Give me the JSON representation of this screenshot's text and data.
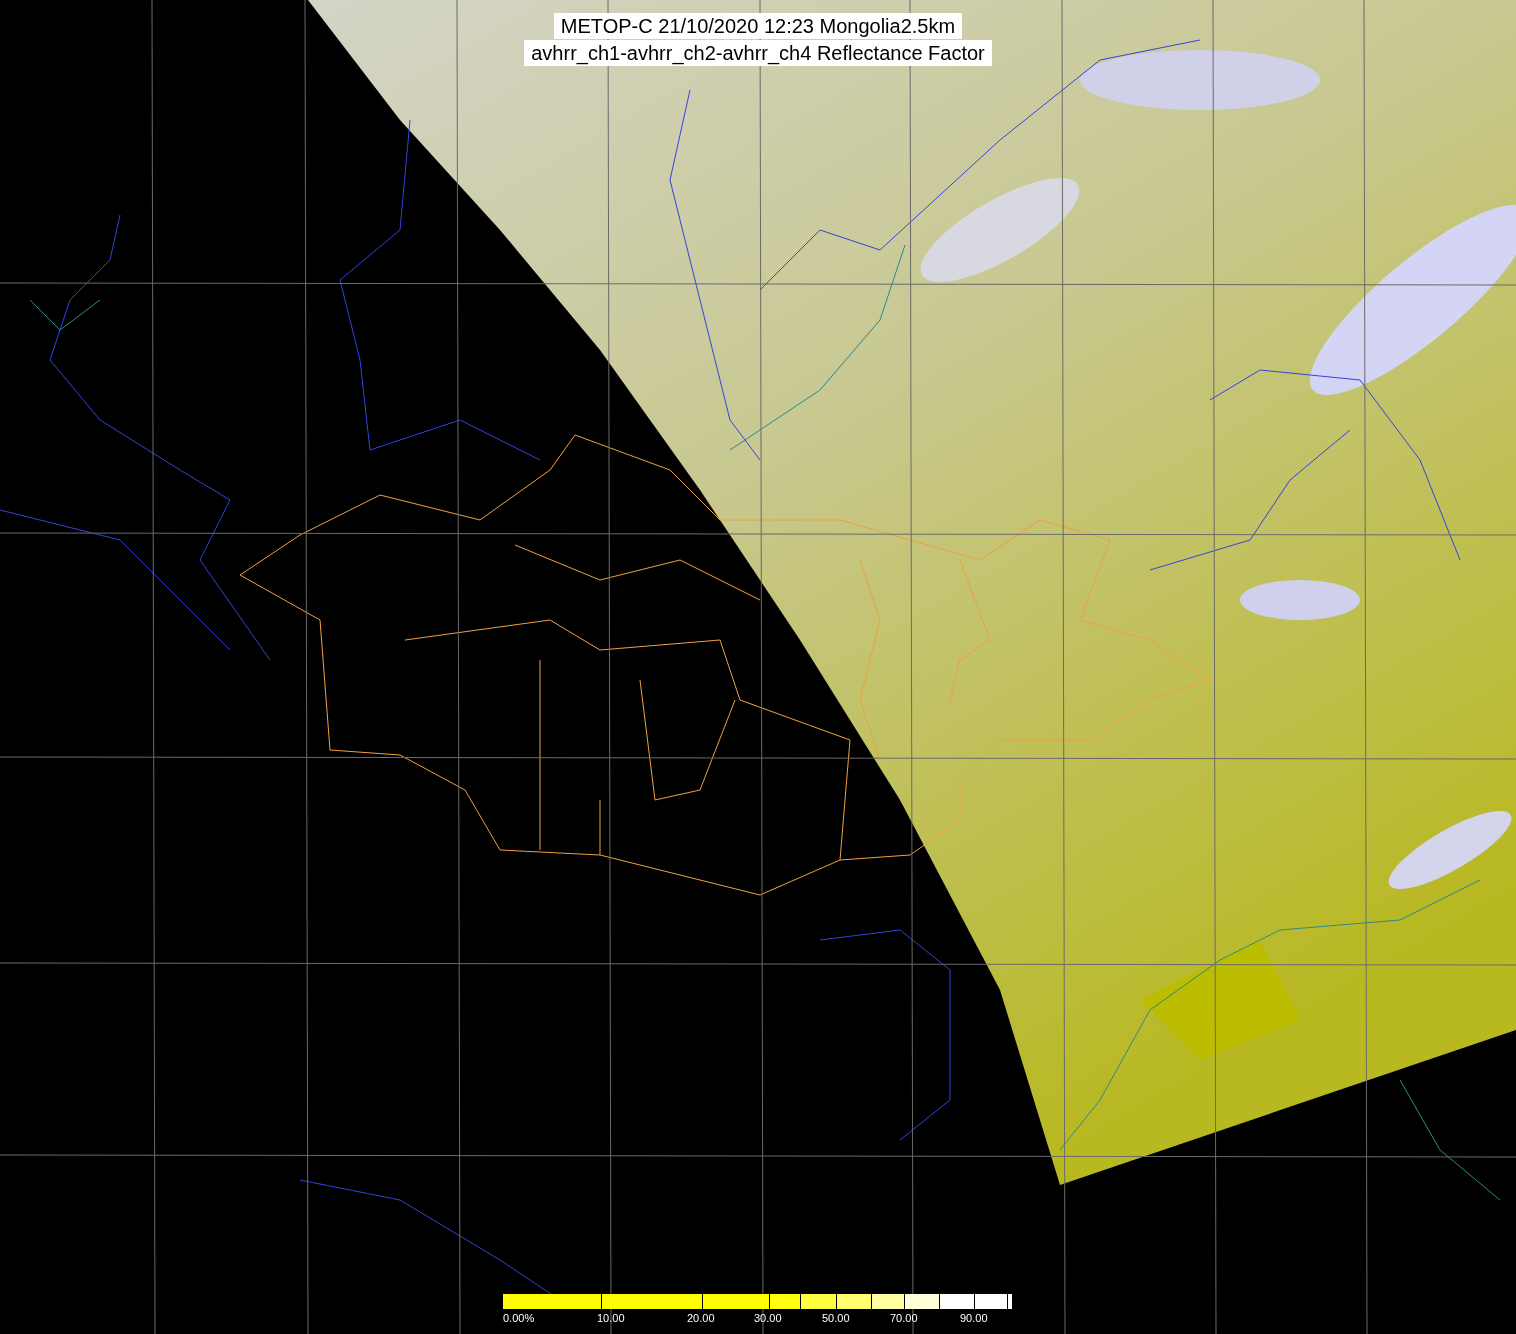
{
  "title": {
    "lines": [
      "METOP-C 21/10/2020 12:23 Mongolia2.5km",
      "avhrr_ch1-avhrr_ch2-avhrr_ch4 Reflectance Factor"
    ]
  },
  "colorbar": {
    "segments": [
      {
        "color": "#ffff00"
      },
      {
        "color": "#ffff00"
      },
      {
        "color": "#ffff00"
      },
      {
        "color": "#ffff10"
      },
      {
        "color": "#ffff40"
      },
      {
        "color": "#ffff70"
      },
      {
        "color": "#ffffa0"
      },
      {
        "color": "#ffffd8"
      },
      {
        "color": "#ffffff"
      },
      {
        "color": "#ffffff"
      },
      {
        "color": "#ffffff"
      }
    ],
    "labels": [
      "0.00%",
      "10.00",
      "20.00",
      "30.00",
      "50.00",
      "70.00",
      "90.00"
    ]
  }
}
